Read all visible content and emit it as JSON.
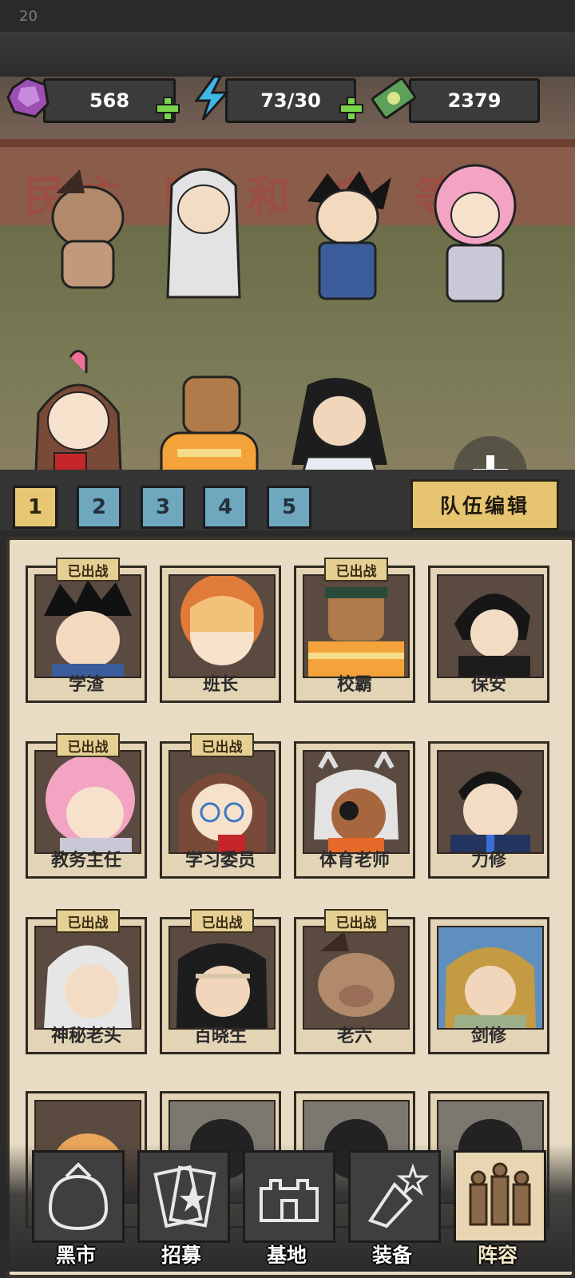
{
  "status": {
    "time": "20"
  },
  "resources": {
    "gems": "568",
    "energy": "73/30",
    "money": "2379"
  },
  "scene": {
    "wall_text": "民主 明 和 自 等"
  },
  "team_tabs": [
    "1",
    "2",
    "3",
    "4",
    "5"
  ],
  "team_active": "1",
  "edit_team_label": "队伍编辑",
  "badge_text": "已出战",
  "heroes": [
    {
      "name": "学渣",
      "deployed": true
    },
    {
      "name": "班长",
      "deployed": false
    },
    {
      "name": "校霸",
      "deployed": true
    },
    {
      "name": "保安",
      "deployed": false
    },
    {
      "name": "教务主任",
      "deployed": true
    },
    {
      "name": "学习委员",
      "deployed": true
    },
    {
      "name": "体育老师",
      "deployed": false
    },
    {
      "name": "力修",
      "deployed": false
    },
    {
      "name": "神秘老头",
      "deployed": true
    },
    {
      "name": "百晓生",
      "deployed": true
    },
    {
      "name": "老六",
      "deployed": true
    },
    {
      "name": "剑修",
      "deployed": false
    }
  ],
  "nav": [
    {
      "label": "黑市",
      "icon": "bag-icon"
    },
    {
      "label": "招募",
      "icon": "cards-icon"
    },
    {
      "label": "基地",
      "icon": "base-icon"
    },
    {
      "label": "装备",
      "icon": "equipment-icon"
    },
    {
      "label": "阵容",
      "icon": "lineup-icon"
    }
  ],
  "nav_active": "阵容",
  "colors": {
    "gem": "#9b4fb3",
    "energy": "#3fb6ea",
    "money": "#5ea05a",
    "plus": "#7ad34a",
    "tab_active": "#e8c774",
    "tab_idle": "#6fa7bf",
    "parchment": "#e8dcc4"
  }
}
